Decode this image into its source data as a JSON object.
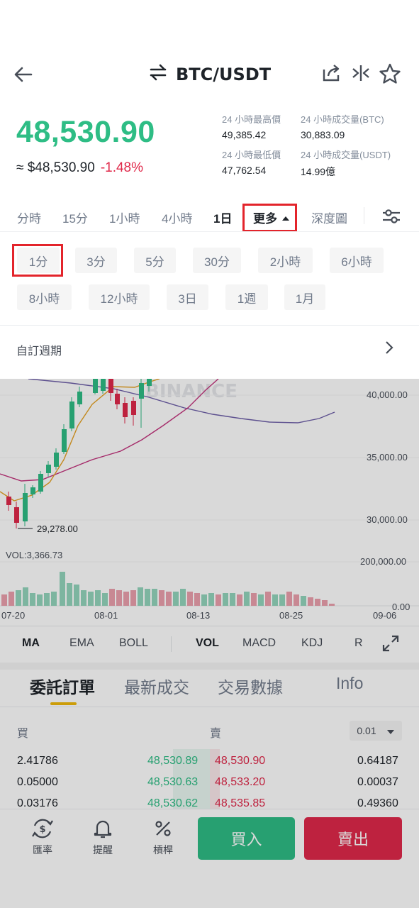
{
  "header": {
    "pair": "BTC/USDT"
  },
  "price": {
    "last": "48,530.90",
    "fiat": "≈ $48,530.90",
    "change": "-1.48%"
  },
  "stats": [
    {
      "label": "24 小時最高價",
      "value": "49,385.42"
    },
    {
      "label": "24 小時成交量(BTC)",
      "value": "30,883.09"
    },
    {
      "label": "24 小時最低價",
      "value": "47,762.54"
    },
    {
      "label": "24 小時成交量(USDT)",
      "value": "14.99億"
    }
  ],
  "intervals": {
    "tabs": [
      "分時",
      "15分",
      "1小時",
      "4小時",
      "1日"
    ],
    "more": "更多",
    "depth": "深度圖"
  },
  "popup": {
    "row1": [
      "1分",
      "3分",
      "5分",
      "30分",
      "2小時",
      "6小時"
    ],
    "row2": [
      "8小時",
      "12小時",
      "3日",
      "1週",
      "1月"
    ],
    "custom": "自訂週期"
  },
  "chart": {
    "watermark": "BINANCE",
    "y_ticks": [
      "40,000.00",
      "35,000.00",
      "30,000.00"
    ],
    "low_marker": "29,278.00",
    "vol_label": "VOL:3,366.73",
    "vol_ticks": [
      "200,000.00",
      "0.00"
    ],
    "x_ticks": [
      "07-20",
      "08-01",
      "08-13",
      "08-25",
      "09-06"
    ]
  },
  "indicators": [
    "MA",
    "EMA",
    "BOLL",
    "VOL",
    "MACD",
    "KDJ",
    "R"
  ],
  "order_tabs": [
    "委託訂單",
    "最新成交",
    "交易數據",
    "Info"
  ],
  "orderbook": {
    "buy": "買",
    "sell": "賣",
    "precision": "0.01",
    "rows": [
      {
        "buy_qty": "2.41786",
        "buy_price": "48,530.89",
        "sell_price": "48,530.90",
        "sell_qty": "0.64187"
      },
      {
        "buy_qty": "0.05000",
        "buy_price": "48,530.63",
        "sell_price": "48,533.20",
        "sell_qty": "0.00037"
      },
      {
        "buy_qty": "0.03176",
        "buy_price": "48,530.62",
        "sell_price": "48,535.85",
        "sell_qty": "0.49360"
      }
    ]
  },
  "bottom": {
    "rate": "匯率",
    "alert": "提醒",
    "leverage": "槓桿",
    "buy": "買入",
    "sell": "賣出"
  },
  "colors": {
    "up": "#2ebd85",
    "down": "#e0294a",
    "highlight": "#e3242b",
    "accent": "#f0b90b"
  }
}
